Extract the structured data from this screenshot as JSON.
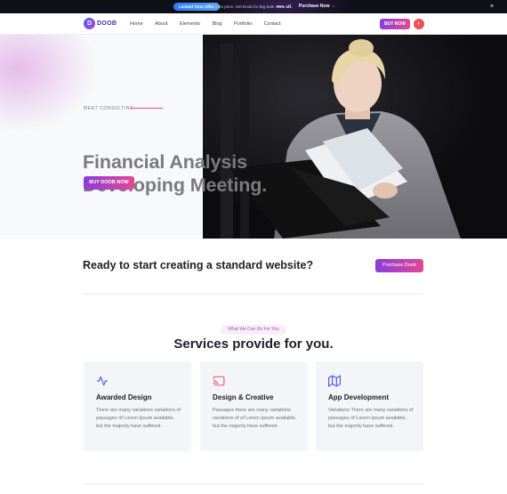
{
  "topbar": {
    "badge": "Limited Time Offer",
    "promo_prefix": "Intro price. Get Doob for Big Sale ",
    "promo_discount": "-95% off.",
    "purchase_label": "Purchase Now",
    "close_symbol": "×"
  },
  "nav": {
    "logo_letter": "D",
    "logo_text": "DOOB",
    "items": [
      "Home",
      "About",
      "Elements",
      "Blog",
      "Portfolio",
      "Contact"
    ],
    "cta_label": "BUY NOW"
  },
  "hero": {
    "eyebrow": "MEET CONSULTING",
    "title_line1": "Financial Analysis",
    "title_line2": "Developing Meeting.",
    "button_label": "BUY DOOB NOW"
  },
  "cta_section": {
    "title": "Ready to start creating a standard website?",
    "button_label": "Purchase Doob"
  },
  "services": {
    "subtitle": "What We Can Do For You",
    "title": "Services provide for you.",
    "cards": [
      {
        "icon": "activity-icon",
        "title": "Awarded Design",
        "text": "There are many variations variations of passages of Lorem Ipsum available, but the majority have suffered."
      },
      {
        "icon": "cast-icon",
        "title": "Design & Creative",
        "text": "Passages there are many variations variations of of Lorem Ipsum available, but the majority have suffered."
      },
      {
        "icon": "map-icon",
        "title": "App Development",
        "text": "Variations There are many variations of passages of Lorem Ipsum available, but the majority have suffered."
      }
    ]
  },
  "colors": {
    "accent_start": "#8a3dd8",
    "accent_end": "#e24895",
    "heading": "#1f1f25",
    "hero_heading": "#7b7b7f"
  }
}
